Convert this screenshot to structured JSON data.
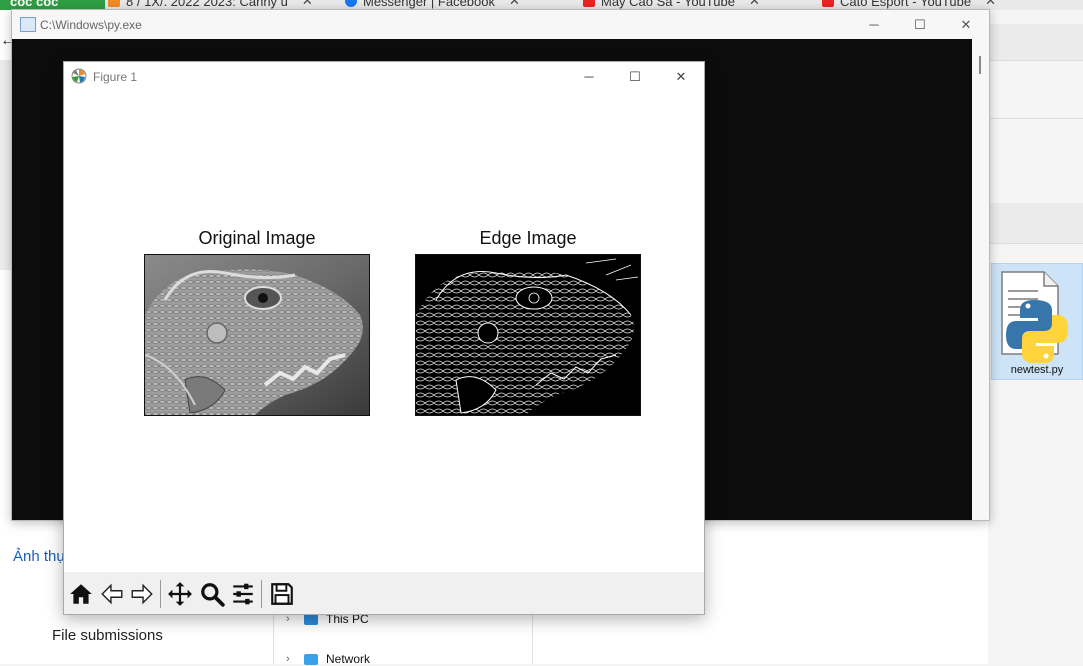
{
  "browser_tabs": [
    {
      "label": "cốc cốc",
      "kind": "brand"
    },
    {
      "label": "8 / 1X/. 2022 2023: Canny u",
      "kind": "tab"
    },
    {
      "label": "Messenger | Facebook",
      "kind": "tab"
    },
    {
      "label": "May Cao Sa - YouTube",
      "kind": "tab"
    },
    {
      "label": "Cato Esport - YouTube",
      "kind": "tab"
    }
  ],
  "background": {
    "link_text": "Ảnh thụ",
    "file_submissions": "File submissions",
    "nav_items": [
      "This PC",
      "Network"
    ],
    "file_tile_name": "newtest.py"
  },
  "console": {
    "title": "C:\\Windows\\py.exe",
    "buttons": {
      "minimize": "─",
      "maximize": "☐",
      "close": "✕"
    }
  },
  "figure": {
    "title": "Figure 1",
    "buttons": {
      "minimize": "─",
      "maximize": "☐",
      "close": "✕"
    },
    "subplots": [
      {
        "title": "Original Image",
        "image": "grayscale iguana photo"
      },
      {
        "title": "Edge Image",
        "image": "canny edge map of iguana"
      }
    ],
    "toolbar": [
      "home-icon",
      "back-icon",
      "forward-icon",
      "pan-icon",
      "zoom-icon",
      "configure-subplots-icon",
      "save-icon"
    ]
  }
}
